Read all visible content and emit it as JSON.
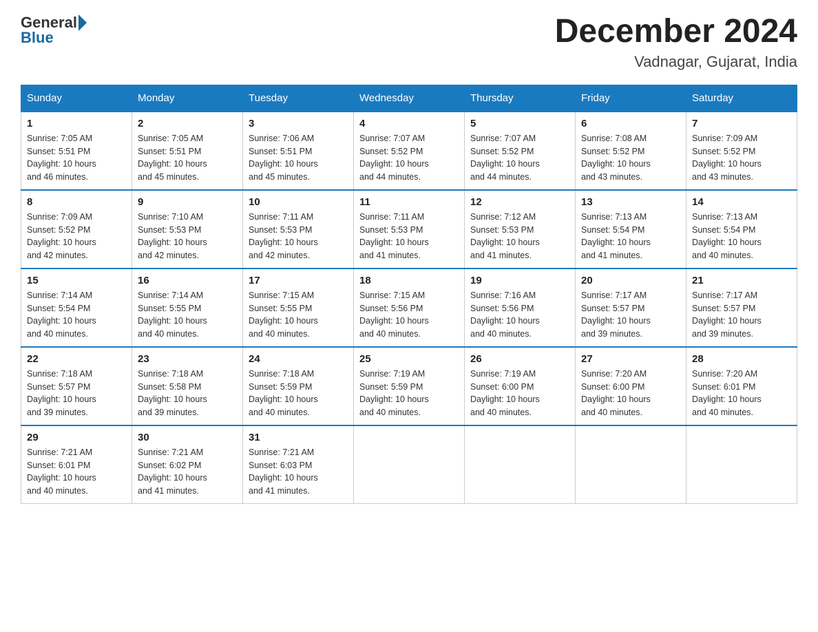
{
  "header": {
    "logo_general": "General",
    "logo_blue": "Blue",
    "title": "December 2024",
    "subtitle": "Vadnagar, Gujarat, India"
  },
  "days_of_week": [
    "Sunday",
    "Monday",
    "Tuesday",
    "Wednesday",
    "Thursday",
    "Friday",
    "Saturday"
  ],
  "weeks": [
    [
      {
        "day": "1",
        "sunrise": "7:05 AM",
        "sunset": "5:51 PM",
        "daylight": "10 hours and 46 minutes."
      },
      {
        "day": "2",
        "sunrise": "7:05 AM",
        "sunset": "5:51 PM",
        "daylight": "10 hours and 45 minutes."
      },
      {
        "day": "3",
        "sunrise": "7:06 AM",
        "sunset": "5:51 PM",
        "daylight": "10 hours and 45 minutes."
      },
      {
        "day": "4",
        "sunrise": "7:07 AM",
        "sunset": "5:52 PM",
        "daylight": "10 hours and 44 minutes."
      },
      {
        "day": "5",
        "sunrise": "7:07 AM",
        "sunset": "5:52 PM",
        "daylight": "10 hours and 44 minutes."
      },
      {
        "day": "6",
        "sunrise": "7:08 AM",
        "sunset": "5:52 PM",
        "daylight": "10 hours and 43 minutes."
      },
      {
        "day": "7",
        "sunrise": "7:09 AM",
        "sunset": "5:52 PM",
        "daylight": "10 hours and 43 minutes."
      }
    ],
    [
      {
        "day": "8",
        "sunrise": "7:09 AM",
        "sunset": "5:52 PM",
        "daylight": "10 hours and 42 minutes."
      },
      {
        "day": "9",
        "sunrise": "7:10 AM",
        "sunset": "5:53 PM",
        "daylight": "10 hours and 42 minutes."
      },
      {
        "day": "10",
        "sunrise": "7:11 AM",
        "sunset": "5:53 PM",
        "daylight": "10 hours and 42 minutes."
      },
      {
        "day": "11",
        "sunrise": "7:11 AM",
        "sunset": "5:53 PM",
        "daylight": "10 hours and 41 minutes."
      },
      {
        "day": "12",
        "sunrise": "7:12 AM",
        "sunset": "5:53 PM",
        "daylight": "10 hours and 41 minutes."
      },
      {
        "day": "13",
        "sunrise": "7:13 AM",
        "sunset": "5:54 PM",
        "daylight": "10 hours and 41 minutes."
      },
      {
        "day": "14",
        "sunrise": "7:13 AM",
        "sunset": "5:54 PM",
        "daylight": "10 hours and 40 minutes."
      }
    ],
    [
      {
        "day": "15",
        "sunrise": "7:14 AM",
        "sunset": "5:54 PM",
        "daylight": "10 hours and 40 minutes."
      },
      {
        "day": "16",
        "sunrise": "7:14 AM",
        "sunset": "5:55 PM",
        "daylight": "10 hours and 40 minutes."
      },
      {
        "day": "17",
        "sunrise": "7:15 AM",
        "sunset": "5:55 PM",
        "daylight": "10 hours and 40 minutes."
      },
      {
        "day": "18",
        "sunrise": "7:15 AM",
        "sunset": "5:56 PM",
        "daylight": "10 hours and 40 minutes."
      },
      {
        "day": "19",
        "sunrise": "7:16 AM",
        "sunset": "5:56 PM",
        "daylight": "10 hours and 40 minutes."
      },
      {
        "day": "20",
        "sunrise": "7:17 AM",
        "sunset": "5:57 PM",
        "daylight": "10 hours and 39 minutes."
      },
      {
        "day": "21",
        "sunrise": "7:17 AM",
        "sunset": "5:57 PM",
        "daylight": "10 hours and 39 minutes."
      }
    ],
    [
      {
        "day": "22",
        "sunrise": "7:18 AM",
        "sunset": "5:57 PM",
        "daylight": "10 hours and 39 minutes."
      },
      {
        "day": "23",
        "sunrise": "7:18 AM",
        "sunset": "5:58 PM",
        "daylight": "10 hours and 39 minutes."
      },
      {
        "day": "24",
        "sunrise": "7:18 AM",
        "sunset": "5:59 PM",
        "daylight": "10 hours and 40 minutes."
      },
      {
        "day": "25",
        "sunrise": "7:19 AM",
        "sunset": "5:59 PM",
        "daylight": "10 hours and 40 minutes."
      },
      {
        "day": "26",
        "sunrise": "7:19 AM",
        "sunset": "6:00 PM",
        "daylight": "10 hours and 40 minutes."
      },
      {
        "day": "27",
        "sunrise": "7:20 AM",
        "sunset": "6:00 PM",
        "daylight": "10 hours and 40 minutes."
      },
      {
        "day": "28",
        "sunrise": "7:20 AM",
        "sunset": "6:01 PM",
        "daylight": "10 hours and 40 minutes."
      }
    ],
    [
      {
        "day": "29",
        "sunrise": "7:21 AM",
        "sunset": "6:01 PM",
        "daylight": "10 hours and 40 minutes."
      },
      {
        "day": "30",
        "sunrise": "7:21 AM",
        "sunset": "6:02 PM",
        "daylight": "10 hours and 41 minutes."
      },
      {
        "day": "31",
        "sunrise": "7:21 AM",
        "sunset": "6:03 PM",
        "daylight": "10 hours and 41 minutes."
      },
      null,
      null,
      null,
      null
    ]
  ],
  "labels": {
    "sunrise": "Sunrise:",
    "sunset": "Sunset:",
    "daylight": "Daylight:"
  }
}
